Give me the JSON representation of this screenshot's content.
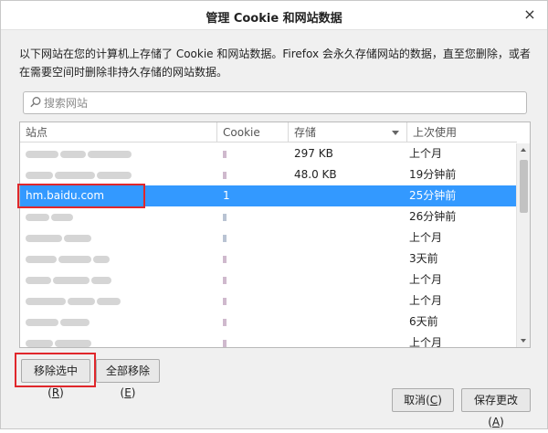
{
  "window": {
    "title": "管理 Cookie 和网站数据",
    "close_glyph": "×"
  },
  "description": "以下网站在您的计算机上存储了 Cookie 和网站数据。Firefox 会永久存储网站的数据，直至您删除，或者在需要空间时删除非持久存储的网站数据。",
  "search": {
    "placeholder": "搜索网站"
  },
  "table": {
    "headers": {
      "site": "站点",
      "cookie": "Cookie",
      "storage": "存储",
      "last_used": "上次使用"
    },
    "rows": [
      {
        "site": "",
        "cookie": "",
        "storage": "297 KB",
        "last_used": "上个月"
      },
      {
        "site": "",
        "cookie": "",
        "storage": "48.0 KB",
        "last_used": "19分钟前"
      },
      {
        "site": "hm.baidu.com",
        "cookie": "1",
        "storage": "",
        "last_used": "25分钟前"
      },
      {
        "site": "",
        "cookie": "",
        "storage": "",
        "last_used": "26分钟前"
      },
      {
        "site": "",
        "cookie": "",
        "storage": "",
        "last_used": "上个月"
      },
      {
        "site": "",
        "cookie": "",
        "storage": "",
        "last_used": "3天前"
      },
      {
        "site": "",
        "cookie": "",
        "storage": "",
        "last_used": "上个月"
      },
      {
        "site": "",
        "cookie": "",
        "storage": "",
        "last_used": "上个月"
      },
      {
        "site": "",
        "cookie": "",
        "storage": "",
        "last_used": "6天前"
      },
      {
        "site": "",
        "cookie": "",
        "storage": "",
        "last_used": "上个月"
      }
    ]
  },
  "buttons": {
    "remove_selected": {
      "label": "移除选中(",
      "key": "R",
      "end": ")"
    },
    "remove_all": {
      "label": "全部移除(",
      "key": "E",
      "end": ")"
    },
    "cancel": {
      "label": "取消(",
      "key": "C",
      "end": ")"
    },
    "save": {
      "label": "保存更改(",
      "key": "A",
      "end": ")"
    }
  },
  "colors": {
    "selection": "#3399ff",
    "highlight_box": "#e0272b"
  }
}
